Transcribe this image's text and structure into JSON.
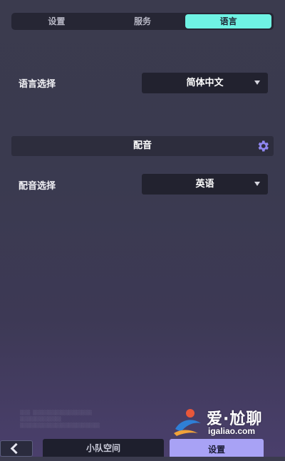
{
  "tabs": [
    {
      "label": "设置",
      "active": false
    },
    {
      "label": "服务",
      "active": false
    },
    {
      "label": "语言",
      "active": true
    }
  ],
  "language": {
    "label": "语言选择",
    "selected": "简体中文"
  },
  "voice_section": {
    "title": "配音",
    "icon": "gear-icon"
  },
  "voice": {
    "label": "配音选择",
    "selected": "英语"
  },
  "bottom_nav": {
    "back_icon": "chevron-left-icon",
    "squad_label": "小队空间",
    "settings_label": "设置"
  },
  "watermark": {
    "text": "爱·尬聊",
    "url": "igaliao.com"
  },
  "colors": {
    "accent_tab": "#6ff3e4",
    "active_bottom_tab": "#a8a2f5",
    "gear": "#8f86f0"
  }
}
